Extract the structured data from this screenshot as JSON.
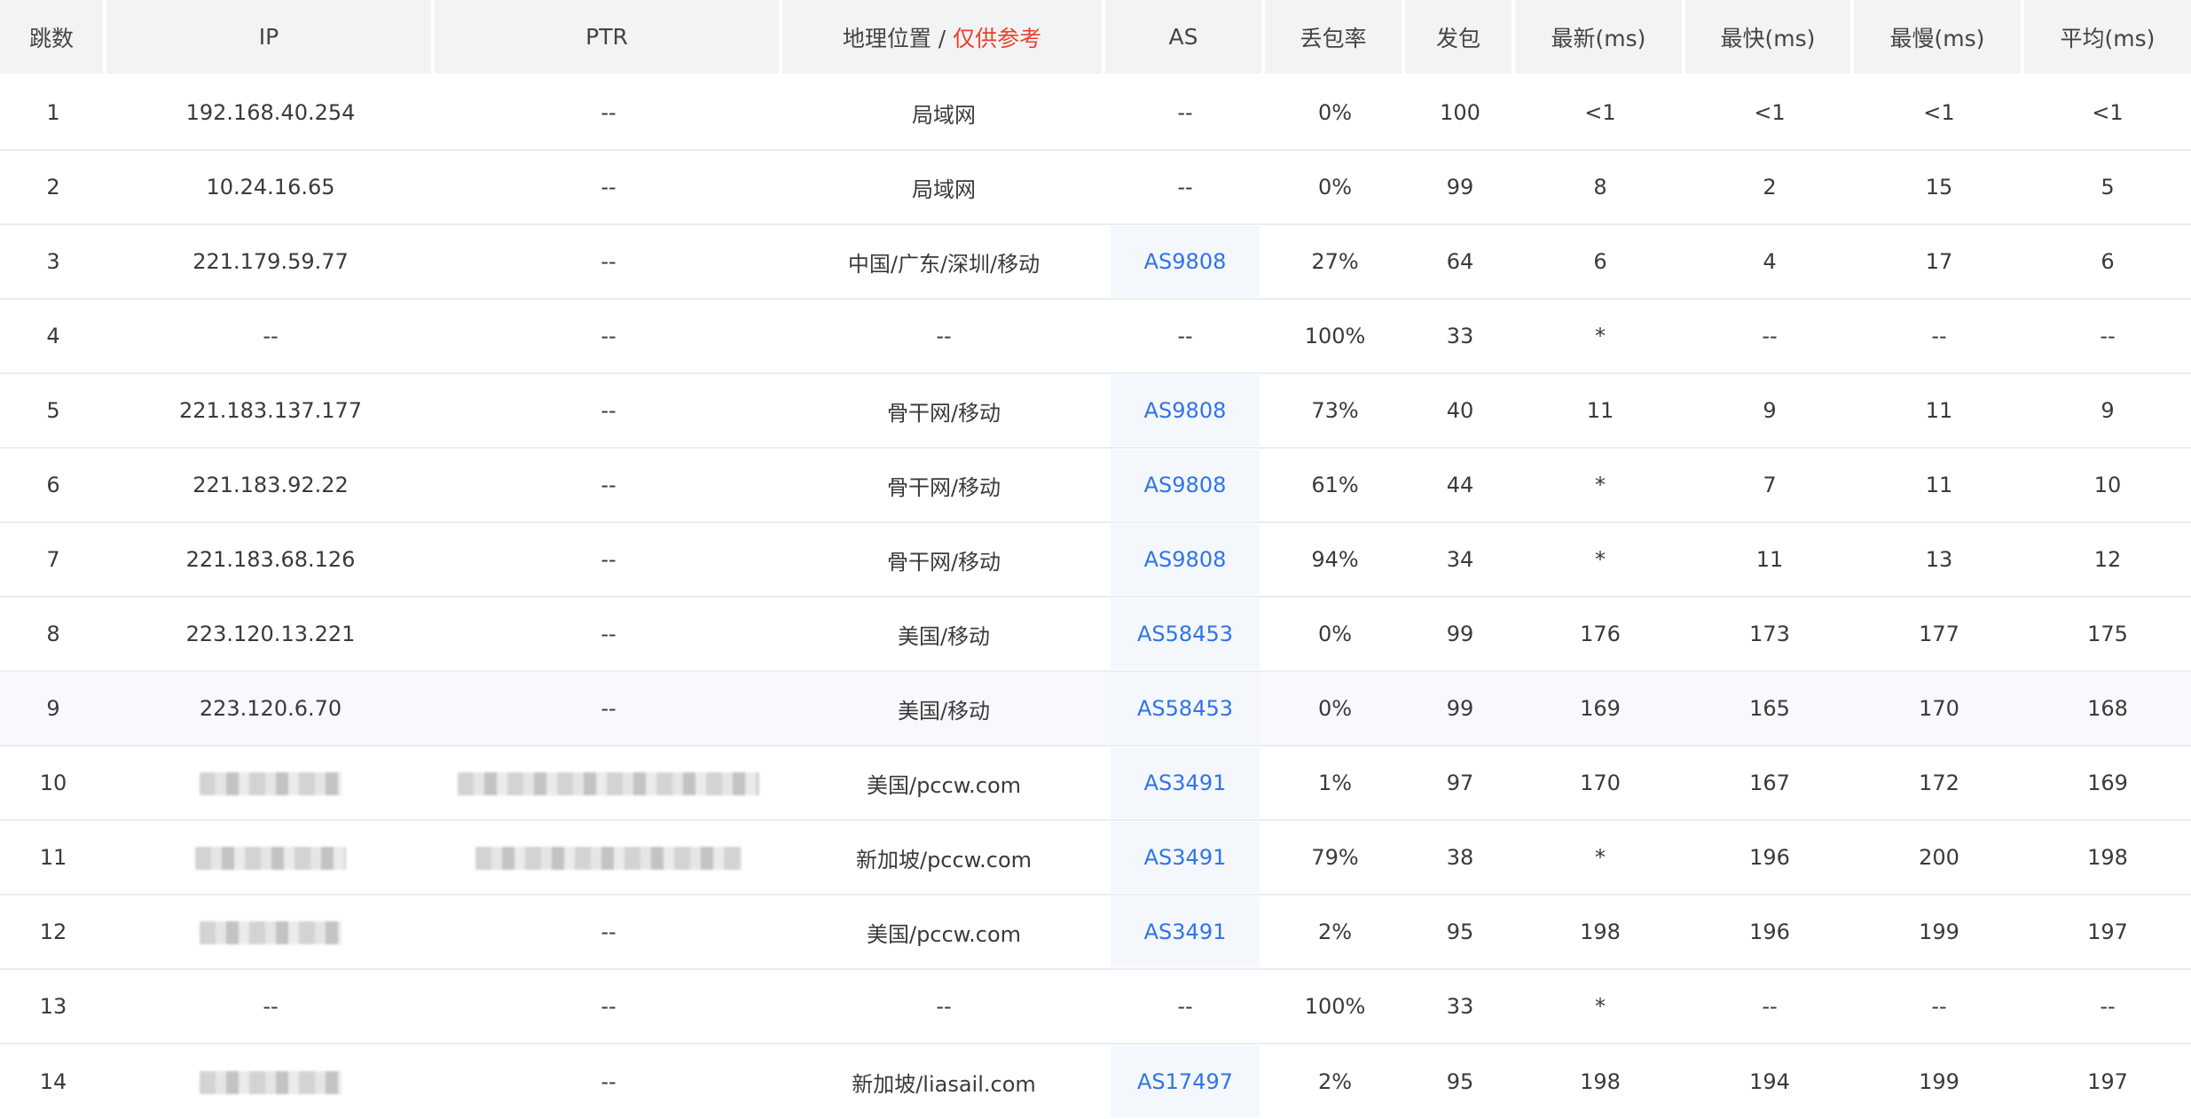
{
  "header": {
    "hop": "跳数",
    "ip": "IP",
    "ptr": "PTR",
    "geo": "地理位置",
    "geo_sep": " / ",
    "geo_note": "仅供参考",
    "as": "AS",
    "loss": "丢包率",
    "sent": "发包",
    "last": "最新(ms)",
    "best": "最快(ms)",
    "worst": "最慢(ms)",
    "avg": "平均(ms)"
  },
  "rows": [
    {
      "hop": "1",
      "ip": "192.168.40.254",
      "ptr": "--",
      "geo": "局域网",
      "as": "--",
      "loss": "0%",
      "sent": "100",
      "last": "<1",
      "best": "<1",
      "worst": "<1",
      "avg": "<1"
    },
    {
      "hop": "2",
      "ip": "10.24.16.65",
      "ptr": "--",
      "geo": "局域网",
      "as": "--",
      "loss": "0%",
      "sent": "99",
      "last": "8",
      "best": "2",
      "worst": "15",
      "avg": "5"
    },
    {
      "hop": "3",
      "ip": "221.179.59.77",
      "ptr": "--",
      "geo": "中国/广东/深圳/移动",
      "as": "AS9808",
      "loss": "27%",
      "sent": "64",
      "last": "6",
      "best": "4",
      "worst": "17",
      "avg": "6"
    },
    {
      "hop": "4",
      "ip": "--",
      "ptr": "--",
      "geo": "--",
      "as": "--",
      "loss": "100%",
      "sent": "33",
      "last": "*",
      "best": "--",
      "worst": "--",
      "avg": "--"
    },
    {
      "hop": "5",
      "ip": "221.183.137.177",
      "ptr": "--",
      "geo": "骨干网/移动",
      "as": "AS9808",
      "loss": "73%",
      "sent": "40",
      "last": "11",
      "best": "9",
      "worst": "11",
      "avg": "9"
    },
    {
      "hop": "6",
      "ip": "221.183.92.22",
      "ptr": "--",
      "geo": "骨干网/移动",
      "as": "AS9808",
      "loss": "61%",
      "sent": "44",
      "last": "*",
      "best": "7",
      "worst": "11",
      "avg": "10"
    },
    {
      "hop": "7",
      "ip": "221.183.68.126",
      "ptr": "--",
      "geo": "骨干网/移动",
      "as": "AS9808",
      "loss": "94%",
      "sent": "34",
      "last": "*",
      "best": "11",
      "worst": "13",
      "avg": "12"
    },
    {
      "hop": "8",
      "ip": "223.120.13.221",
      "ptr": "--",
      "geo": "美国/移动",
      "as": "AS58453",
      "loss": "0%",
      "sent": "99",
      "last": "176",
      "best": "173",
      "worst": "177",
      "avg": "175"
    },
    {
      "hop": "9",
      "ip": "223.120.6.70",
      "ptr": "--",
      "geo": "美国/移动",
      "as": "AS58453",
      "loss": "0%",
      "sent": "99",
      "last": "169",
      "best": "165",
      "worst": "170",
      "avg": "168"
    },
    {
      "hop": "10",
      "ip": "",
      "ptr": "",
      "geo": "美国/pccw.com",
      "as": "AS3491",
      "loss": "1%",
      "sent": "97",
      "last": "170",
      "best": "167",
      "worst": "172",
      "avg": "169"
    },
    {
      "hop": "11",
      "ip": "",
      "ptr": "",
      "geo": "新加坡/pccw.com",
      "as": "AS3491",
      "loss": "79%",
      "sent": "38",
      "last": "*",
      "best": "196",
      "worst": "200",
      "avg": "198"
    },
    {
      "hop": "12",
      "ip": "",
      "ptr": "--",
      "geo": "美国/pccw.com",
      "as": "AS3491",
      "loss": "2%",
      "sent": "95",
      "last": "198",
      "best": "196",
      "worst": "199",
      "avg": "197"
    },
    {
      "hop": "13",
      "ip": "--",
      "ptr": "--",
      "geo": "--",
      "as": "--",
      "loss": "100%",
      "sent": "33",
      "last": "*",
      "best": "--",
      "worst": "--",
      "avg": "--"
    },
    {
      "hop": "14",
      "ip": "",
      "ptr": "--",
      "geo": "新加坡/liasail.com",
      "as": "AS17497",
      "loss": "2%",
      "sent": "95",
      "last": "198",
      "best": "194",
      "worst": "199",
      "avg": "197"
    }
  ],
  "highlighted_hop": "9",
  "colors": {
    "header_bg": "#f2f3f5",
    "as_link": "#2f74e8",
    "geo_note": "#e8412f",
    "row_highlight": "#f7f9fc",
    "divider": "#ebedf0"
  }
}
